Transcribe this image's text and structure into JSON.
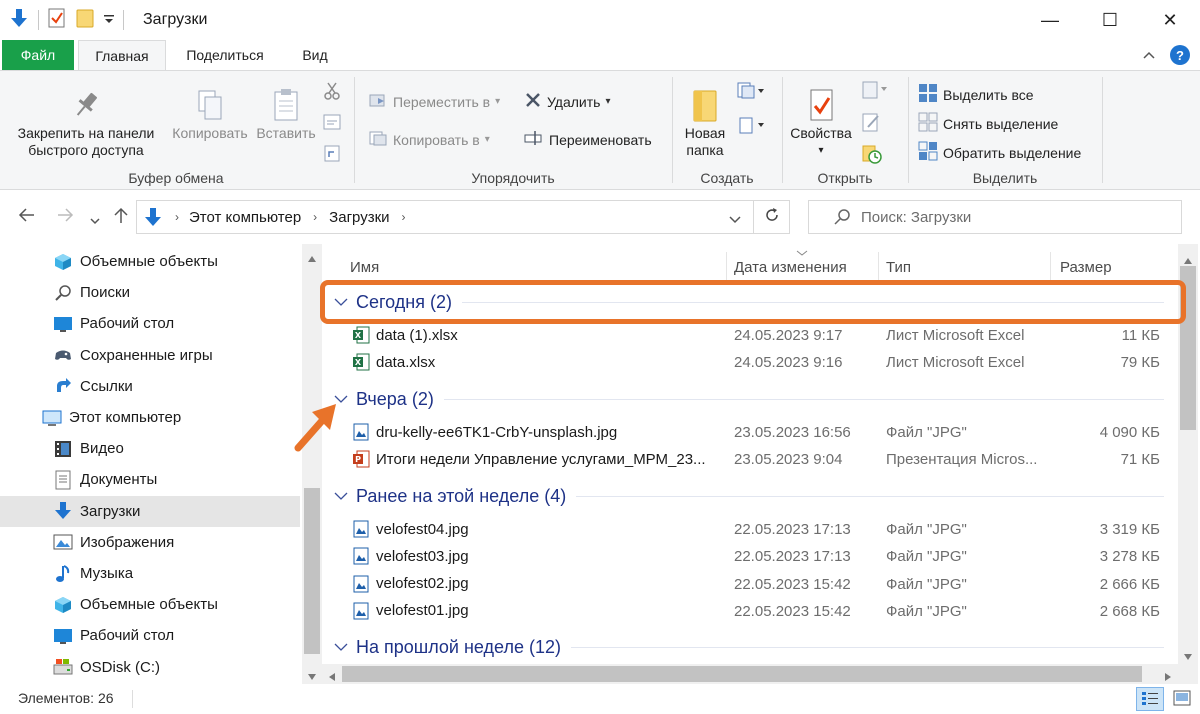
{
  "window": {
    "title": "Загрузки",
    "minimize_glyph": "—",
    "maximize_glyph": "☐",
    "close_glyph": "✕"
  },
  "ribbon_tabs": [
    {
      "label": "Файл"
    },
    {
      "label": "Главная"
    },
    {
      "label": "Поделиться"
    },
    {
      "label": "Вид"
    }
  ],
  "ribbon": {
    "clipboard": {
      "pin_label_1": "Закрепить на панели",
      "pin_label_2": "быстрого доступа",
      "copy_label": "Копировать",
      "paste_label": "Вставить",
      "group_label": "Буфер обмена"
    },
    "organize": {
      "move_to": "Переместить в",
      "copy_to": "Копировать в",
      "delete": "Удалить",
      "rename": "Переименовать",
      "group_label": "Упорядочить"
    },
    "new": {
      "new_folder_1": "Новая",
      "new_folder_2": "папка",
      "group_label": "Создать"
    },
    "open": {
      "properties": "Свойства",
      "group_label": "Открыть"
    },
    "select": {
      "select_all": "Выделить все",
      "select_none": "Снять выделение",
      "invert": "Обратить выделение",
      "group_label": "Выделить"
    }
  },
  "address": {
    "breadcrumb": [
      "Этот компьютер",
      "Загрузки"
    ],
    "search_placeholder": "Поиск: Загрузки"
  },
  "nav_pane": [
    {
      "label": "Объемные объекты",
      "icon": "3d-objects-icon",
      "indent": 1
    },
    {
      "label": "Поиски",
      "icon": "search-folder-icon",
      "indent": 1
    },
    {
      "label": "Рабочий стол",
      "icon": "desktop-icon",
      "indent": 1
    },
    {
      "label": "Сохраненные игры",
      "icon": "saved-games-icon",
      "indent": 1
    },
    {
      "label": "Ссылки",
      "icon": "links-icon",
      "indent": 1
    },
    {
      "label": "Этот компьютер",
      "icon": "this-pc-icon",
      "indent": 0
    },
    {
      "label": "Видео",
      "icon": "video-icon",
      "indent": 1
    },
    {
      "label": "Документы",
      "icon": "documents-icon",
      "indent": 1
    },
    {
      "label": "Загрузки",
      "icon": "downloads-icon",
      "indent": 1,
      "selected": true
    },
    {
      "label": "Изображения",
      "icon": "pictures-icon",
      "indent": 1
    },
    {
      "label": "Музыка",
      "icon": "music-icon",
      "indent": 1
    },
    {
      "label": "Объемные объекты",
      "icon": "3d-objects-icon",
      "indent": 1
    },
    {
      "label": "Рабочий стол",
      "icon": "desktop-icon",
      "indent": 1
    },
    {
      "label": "OSDisk (C:)",
      "icon": "disk-icon",
      "indent": 1
    }
  ],
  "columns": {
    "name": "Имя",
    "date": "Дата изменения",
    "type": "Тип",
    "size": "Размер"
  },
  "groups": [
    {
      "label": "Сегодня (2)",
      "files": [
        {
          "name": "data (1).xlsx",
          "date": "24.05.2023 9:17",
          "type": "Лист Microsoft Excel",
          "size": "11 КБ",
          "icon": "excel-icon"
        },
        {
          "name": "data.xlsx",
          "date": "24.05.2023 9:16",
          "type": "Лист Microsoft Excel",
          "size": "79 КБ",
          "icon": "excel-icon"
        }
      ]
    },
    {
      "label": "Вчера (2)",
      "files": [
        {
          "name": "dru-kelly-ee6TK1-CrbY-unsplash.jpg",
          "date": "23.05.2023 16:56",
          "type": "Файл \"JPG\"",
          "size": "4 090 КБ",
          "icon": "image-icon"
        },
        {
          "name": "Итоги недели Управление услугами_МРМ_23...",
          "date": "23.05.2023 9:04",
          "type": "Презентация Micros...",
          "size": "71 КБ",
          "icon": "powerpoint-icon"
        }
      ]
    },
    {
      "label": "Ранее на этой неделе (4)",
      "files": [
        {
          "name": "velofest04.jpg",
          "date": "22.05.2023 17:13",
          "type": "Файл \"JPG\"",
          "size": "3 319 КБ",
          "icon": "image-icon"
        },
        {
          "name": "velofest03.jpg",
          "date": "22.05.2023 17:13",
          "type": "Файл \"JPG\"",
          "size": "3 278 КБ",
          "icon": "image-icon"
        },
        {
          "name": "velofest02.jpg",
          "date": "22.05.2023 15:42",
          "type": "Файл \"JPG\"",
          "size": "2 666 КБ",
          "icon": "image-icon"
        },
        {
          "name": "velofest01.jpg",
          "date": "22.05.2023 15:42",
          "type": "Файл \"JPG\"",
          "size": "2 668 КБ",
          "icon": "image-icon"
        }
      ]
    },
    {
      "label": "На прошлой неделе (12)",
      "files": []
    }
  ],
  "status": {
    "items_count": "Элементов: 26"
  },
  "colors": {
    "accent_blue": "#1e73cf",
    "group_header": "#1e3287",
    "highlight": "#e8732a",
    "file_tab": "#19a04a"
  }
}
